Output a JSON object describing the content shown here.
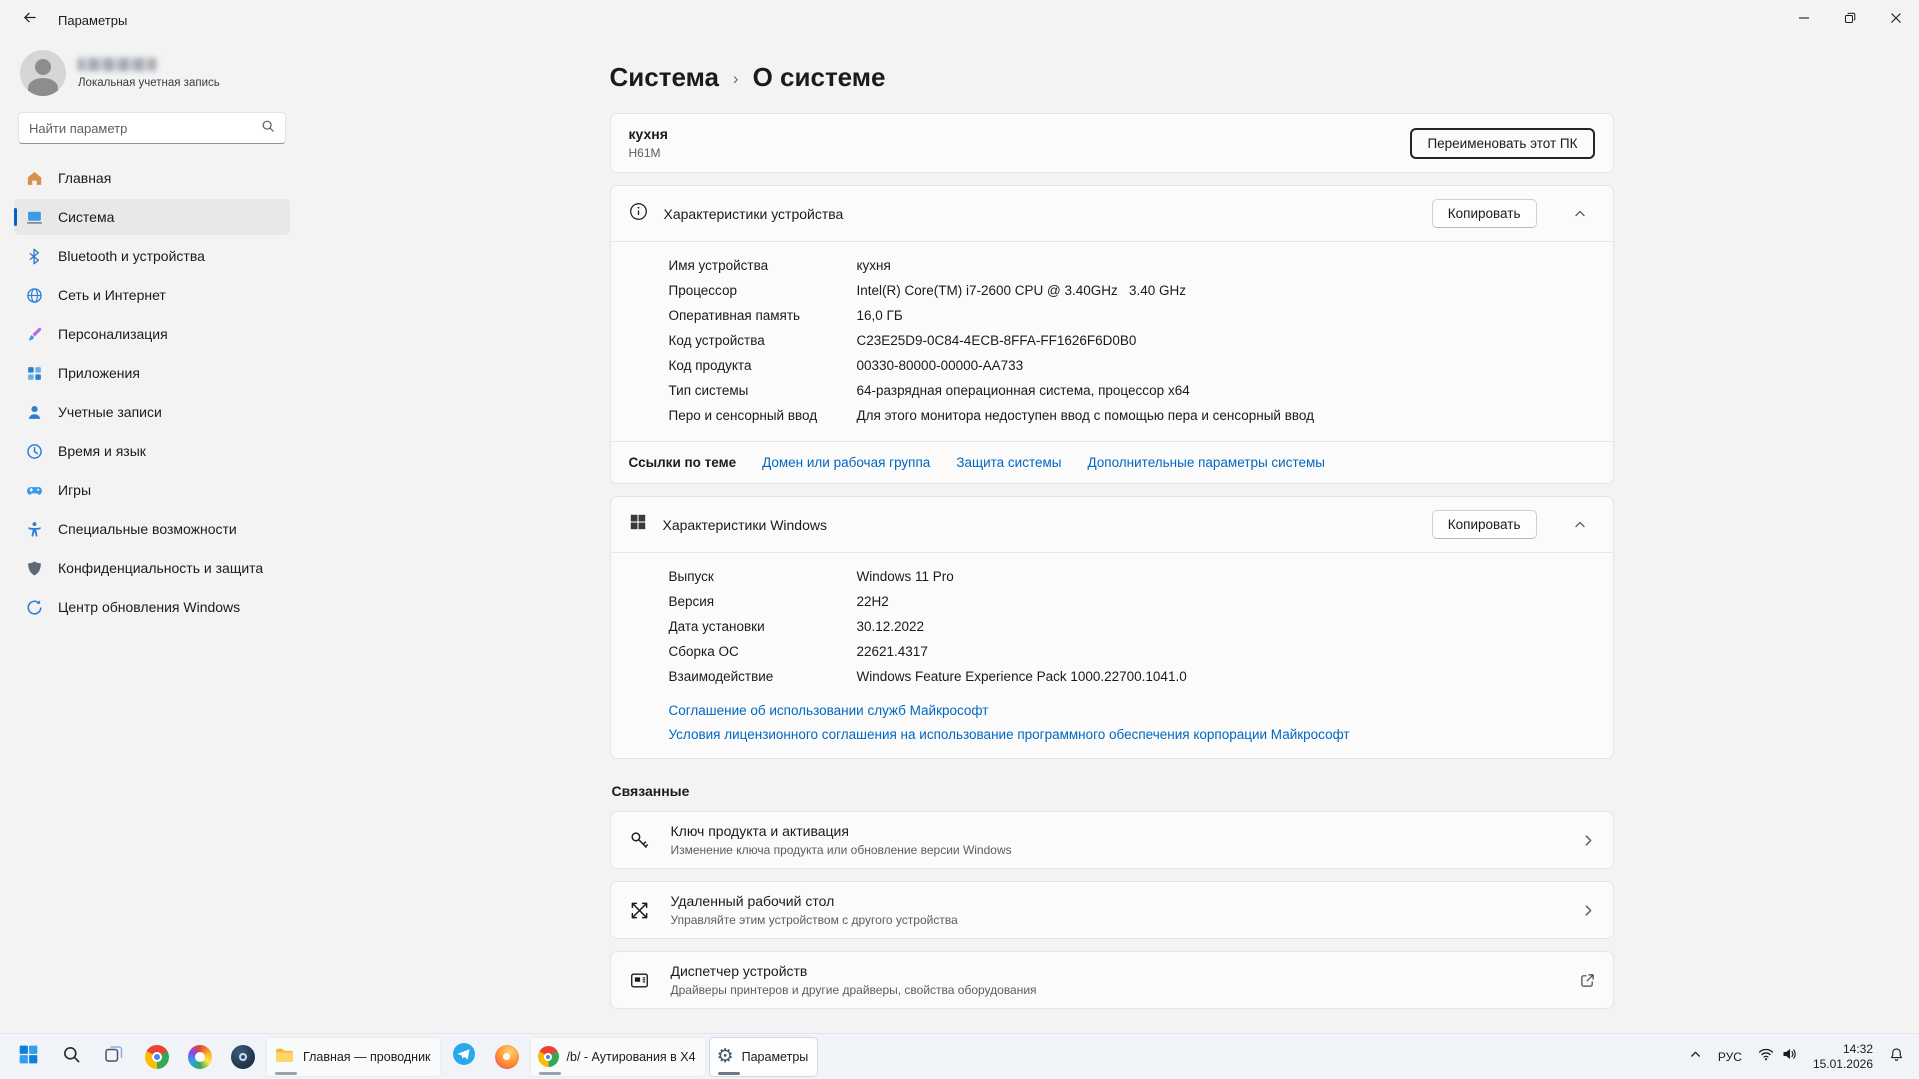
{
  "titlebar": {
    "title": "Параметры"
  },
  "sidebar": {
    "account": {
      "subtitle": "Локальная учетная запись"
    },
    "search": {
      "placeholder": "Найти параметр"
    },
    "items": [
      {
        "label": "Главная"
      },
      {
        "label": "Система"
      },
      {
        "label": "Bluetooth и устройства"
      },
      {
        "label": "Сеть и Интернет"
      },
      {
        "label": "Персонализация"
      },
      {
        "label": "Приложения"
      },
      {
        "label": "Учетные записи"
      },
      {
        "label": "Время и язык"
      },
      {
        "label": "Игры"
      },
      {
        "label": "Специальные возможности"
      },
      {
        "label": "Конфиденциальность и защита"
      },
      {
        "label": "Центр обновления Windows"
      }
    ]
  },
  "breadcrumb": {
    "parent": "Система",
    "separator": "›",
    "current": "О системе"
  },
  "device_card": {
    "name": "кухня",
    "model": "H61M",
    "rename_button": "Переименовать этот ПК"
  },
  "device_specs": {
    "title": "Характеристики устройства",
    "copy_button": "Копировать",
    "rows": [
      {
        "label": "Имя устройства",
        "value": "кухня"
      },
      {
        "label": "Процессор",
        "value": "Intel(R) Core(TM) i7-2600 CPU @ 3.40GHz   3.40 GHz"
      },
      {
        "label": "Оперативная память",
        "value": "16,0 ГБ"
      },
      {
        "label": "Код устройства",
        "value": "C23E25D9-0C84-4ECB-8FFA-FF1626F6D0B0"
      },
      {
        "label": "Код продукта",
        "value": "00330-80000-00000-AA733"
      },
      {
        "label": "Тип системы",
        "value": "64-разрядная операционная система, процессор x64"
      },
      {
        "label": "Перо и сенсорный ввод",
        "value": "Для этого монитора недоступен ввод с помощью пера и сенсорный ввод"
      }
    ],
    "footer": {
      "label": "Ссылки по теме",
      "links": [
        "Домен или рабочая группа",
        "Защита системы",
        "Дополнительные параметры системы"
      ]
    }
  },
  "windows_specs": {
    "title": "Характеристики Windows",
    "copy_button": "Копировать",
    "rows": [
      {
        "label": "Выпуск",
        "value": "Windows 11 Pro"
      },
      {
        "label": "Версия",
        "value": "22H2"
      },
      {
        "label": "Дата установки",
        "value": "30.12.2022"
      },
      {
        "label": "Сборка ОС",
        "value": "22621.4317"
      },
      {
        "label": "Взаимодействие",
        "value": "Windows Feature Experience Pack 1000.22700.1041.0"
      }
    ],
    "links": [
      "Соглашение об использовании служб Майкрософт",
      "Условия лицензионного соглашения на использование программного обеспечения корпорации Майкрософт"
    ]
  },
  "related": {
    "title": "Связанные",
    "items": [
      {
        "title": "Ключ продукта и активация",
        "subtitle": "Изменение ключа продукта или обновление версии Windows"
      },
      {
        "title": "Удаленный рабочий стол",
        "subtitle": "Управляйте этим устройством с другого устройства"
      },
      {
        "title": "Диспетчер устройств",
        "subtitle": "Драйверы принтеров и другие драйверы, свойства оборудования"
      }
    ]
  },
  "taskbar": {
    "windows": [
      {
        "title": "Главная — проводник"
      },
      {
        "title": "/b/ - Аутирования в X4"
      },
      {
        "title": "Параметры"
      }
    ],
    "tray": {
      "language": "РУС",
      "time": "14:32",
      "date": "15.01.2026"
    }
  }
}
